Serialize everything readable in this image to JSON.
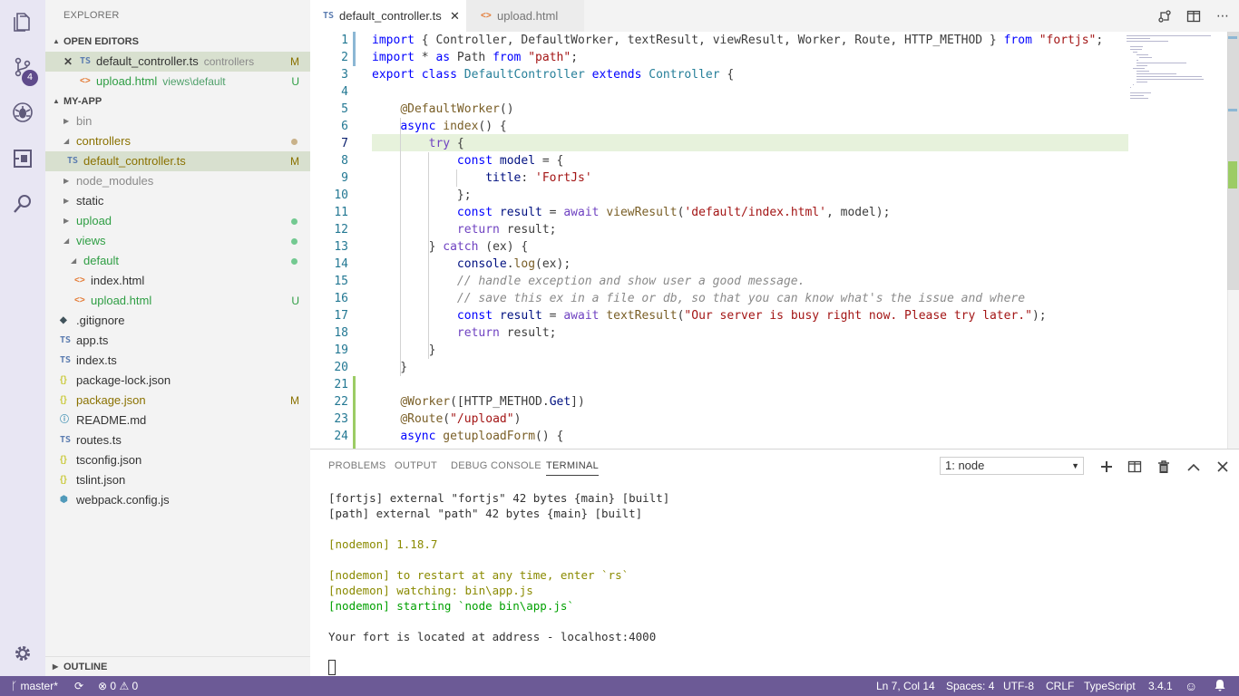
{
  "activity_bar": {
    "items": [
      {
        "icon": "files-icon"
      },
      {
        "icon": "source-control-icon",
        "badge": "4"
      },
      {
        "icon": "debug-icon"
      },
      {
        "icon": "extensions-icon"
      },
      {
        "icon": "search-icon"
      }
    ],
    "bottom": {
      "icon": "gear-icon"
    }
  },
  "sidebar": {
    "title": "EXPLORER",
    "open_editors": {
      "label": "OPEN EDITORS",
      "items": [
        {
          "icon_text": "TS",
          "name": "default_controller.ts",
          "desc": "controllers",
          "status": "M",
          "close": "✕"
        },
        {
          "icon_text": "<>",
          "name": "upload.html",
          "desc": "views\\default",
          "status": "U"
        }
      ]
    },
    "project": {
      "label": "MY-APP",
      "items": [
        {
          "name": "bin",
          "type": "folder"
        },
        {
          "name": "controllers",
          "type": "folder"
        },
        {
          "name": "default_controller.ts",
          "icon_text": "TS",
          "status": "M"
        },
        {
          "name": "node_modules",
          "type": "folder"
        },
        {
          "name": "static",
          "type": "folder"
        },
        {
          "name": "upload",
          "type": "folder"
        },
        {
          "name": "views",
          "type": "folder"
        },
        {
          "name": "default",
          "type": "folder"
        },
        {
          "name": "index.html",
          "icon_text": "<>"
        },
        {
          "name": "upload.html",
          "icon_text": "<>",
          "status": "U"
        },
        {
          "name": ".gitignore",
          "icon_text": "◆"
        },
        {
          "name": "app.ts",
          "icon_text": "TS"
        },
        {
          "name": "index.ts",
          "icon_text": "TS"
        },
        {
          "name": "package-lock.json",
          "icon_text": "{}"
        },
        {
          "name": "package.json",
          "icon_text": "{}",
          "status": "M"
        },
        {
          "name": "README.md",
          "icon_text": "ⓘ"
        },
        {
          "name": "routes.ts",
          "icon_text": "TS"
        },
        {
          "name": "tsconfig.json",
          "icon_text": "{}"
        },
        {
          "name": "tslint.json",
          "icon_text": "{}"
        },
        {
          "name": "webpack.config.js",
          "icon_text": "⬢"
        }
      ]
    },
    "outline": {
      "label": "OUTLINE"
    }
  },
  "tabs": [
    {
      "icon_text": "TS",
      "label": "default_controller.ts",
      "active": true,
      "close": "✕"
    },
    {
      "icon_text": "<>",
      "label": "upload.html",
      "active": false
    }
  ],
  "editor": {
    "lines": [
      {
        "n": "1",
        "parts": [
          [
            "kw",
            "import"
          ],
          [
            "pl",
            " { Controller, DefaultWorker, textResult, viewResult, Worker, Route, HTTP_METHOD } "
          ],
          [
            "kw",
            "from"
          ],
          [
            "pl",
            " "
          ],
          [
            "str",
            "\"fortjs\""
          ],
          [
            "pl",
            ";"
          ]
        ]
      },
      {
        "n": "2",
        "parts": [
          [
            "kw",
            "import"
          ],
          [
            "pl",
            " * "
          ],
          [
            "kw",
            "as"
          ],
          [
            "pl",
            " Path "
          ],
          [
            "kw",
            "from"
          ],
          [
            "pl",
            " "
          ],
          [
            "str",
            "\"path\""
          ],
          [
            "pl",
            ";"
          ]
        ]
      },
      {
        "n": "3",
        "parts": [
          [
            "kw",
            "export"
          ],
          [
            "pl",
            " "
          ],
          [
            "kw",
            "class"
          ],
          [
            "pl",
            " "
          ],
          [
            "cls",
            "DefaultController"
          ],
          [
            "pl",
            " "
          ],
          [
            "kw",
            "extends"
          ],
          [
            "pl",
            " "
          ],
          [
            "cls",
            "Controller"
          ],
          [
            "pl",
            " {"
          ]
        ]
      },
      {
        "n": "4",
        "parts": []
      },
      {
        "n": "5",
        "parts": [
          [
            "pl",
            "    "
          ],
          [
            "dec",
            "@DefaultWorker"
          ],
          [
            "pl",
            "()"
          ]
        ]
      },
      {
        "n": "6",
        "parts": [
          [
            "pl",
            "    "
          ],
          [
            "kw",
            "async"
          ],
          [
            "pl",
            " "
          ],
          [
            "fn",
            "index"
          ],
          [
            "pl",
            "() {"
          ]
        ]
      },
      {
        "n": "7",
        "parts": [
          [
            "pl",
            "        "
          ],
          [
            "kw2",
            "try"
          ],
          [
            "pl",
            " {"
          ]
        ]
      },
      {
        "n": "8",
        "parts": [
          [
            "pl",
            "            "
          ],
          [
            "kw",
            "const"
          ],
          [
            "pl",
            " "
          ],
          [
            "prop",
            "model"
          ],
          [
            "pl",
            " = {"
          ]
        ]
      },
      {
        "n": "9",
        "parts": [
          [
            "pl",
            "                "
          ],
          [
            "prop",
            "title"
          ],
          [
            "pl",
            ": "
          ],
          [
            "str",
            "'FortJs'"
          ]
        ]
      },
      {
        "n": "10",
        "parts": [
          [
            "pl",
            "            };"
          ]
        ]
      },
      {
        "n": "11",
        "parts": [
          [
            "pl",
            "            "
          ],
          [
            "kw",
            "const"
          ],
          [
            "pl",
            " "
          ],
          [
            "prop",
            "result"
          ],
          [
            "pl",
            " = "
          ],
          [
            "kw2",
            "await"
          ],
          [
            "pl",
            " "
          ],
          [
            "fn",
            "viewResult"
          ],
          [
            "pl",
            "("
          ],
          [
            "str",
            "'default/index.html'"
          ],
          [
            "pl",
            ", model);"
          ]
        ]
      },
      {
        "n": "12",
        "parts": [
          [
            "pl",
            "            "
          ],
          [
            "kw2",
            "return"
          ],
          [
            "pl",
            " result;"
          ]
        ]
      },
      {
        "n": "13",
        "parts": [
          [
            "pl",
            "        } "
          ],
          [
            "kw2",
            "catch"
          ],
          [
            "pl",
            " (ex) {"
          ]
        ]
      },
      {
        "n": "14",
        "parts": [
          [
            "pl",
            "            "
          ],
          [
            "prop",
            "console"
          ],
          [
            "pl",
            "."
          ],
          [
            "fn",
            "log"
          ],
          [
            "pl",
            "(ex);"
          ]
        ]
      },
      {
        "n": "15",
        "parts": [
          [
            "pl",
            "            "
          ],
          [
            "cmt",
            "// handle exception and show user a good message."
          ]
        ]
      },
      {
        "n": "16",
        "parts": [
          [
            "pl",
            "            "
          ],
          [
            "cmt",
            "// save this ex in a file or db, so that you can know what's the issue and where"
          ]
        ]
      },
      {
        "n": "17",
        "parts": [
          [
            "pl",
            "            "
          ],
          [
            "kw",
            "const"
          ],
          [
            "pl",
            " "
          ],
          [
            "prop",
            "result"
          ],
          [
            "pl",
            " = "
          ],
          [
            "kw2",
            "await"
          ],
          [
            "pl",
            " "
          ],
          [
            "fn",
            "textResult"
          ],
          [
            "pl",
            "("
          ],
          [
            "str",
            "\"Our server is busy right now. Please try later.\""
          ],
          [
            "pl",
            ");"
          ]
        ]
      },
      {
        "n": "18",
        "parts": [
          [
            "pl",
            "            "
          ],
          [
            "kw2",
            "return"
          ],
          [
            "pl",
            " result;"
          ]
        ]
      },
      {
        "n": "19",
        "parts": [
          [
            "pl",
            "        }"
          ]
        ]
      },
      {
        "n": "20",
        "parts": [
          [
            "pl",
            "    }"
          ]
        ]
      },
      {
        "n": "21",
        "parts": []
      },
      {
        "n": "22",
        "parts": [
          [
            "pl",
            "    "
          ],
          [
            "dec",
            "@Worker"
          ],
          [
            "pl",
            "([HTTP_METHOD."
          ],
          [
            "prop",
            "Get"
          ],
          [
            "pl",
            "])"
          ]
        ]
      },
      {
        "n": "23",
        "parts": [
          [
            "pl",
            "    "
          ],
          [
            "dec",
            "@Route"
          ],
          [
            "pl",
            "("
          ],
          [
            "str",
            "\"/upload\""
          ],
          [
            "pl",
            ")"
          ]
        ]
      },
      {
        "n": "24",
        "parts": [
          [
            "pl",
            "    "
          ],
          [
            "kw",
            "async"
          ],
          [
            "pl",
            " "
          ],
          [
            "fn",
            "getuploadForm"
          ],
          [
            "pl",
            "() {"
          ]
        ]
      }
    ],
    "current_line": "7"
  },
  "panel": {
    "tabs": [
      "PROBLEMS",
      "OUTPUT",
      "DEBUG CONSOLE",
      "TERMINAL"
    ],
    "active_tab": "TERMINAL",
    "terminal_select": "1: node",
    "terminal_lines": [
      {
        "text": "[fortjs] external \"fortjs\" 42 bytes {main} [built]",
        "color": "default"
      },
      {
        "text": "[path] external \"path\" 42 bytes {main} [built]",
        "color": "default"
      },
      {
        "text": "",
        "color": "default"
      },
      {
        "text": "[nodemon] 1.18.7",
        "color": "yellow"
      },
      {
        "text": "",
        "color": "default"
      },
      {
        "text": "[nodemon] to restart at any time, enter `rs`",
        "color": "yellow"
      },
      {
        "text": "[nodemon] watching: bin\\app.js",
        "color": "yellow"
      },
      {
        "text": "[nodemon] starting `node bin\\app.js`",
        "color": "green"
      },
      {
        "text": "",
        "color": "default"
      },
      {
        "text": "Your fort is located at address - localhost:4000",
        "color": "default"
      }
    ]
  },
  "statusbar": {
    "branch": "master*",
    "errors": "0",
    "warnings": "0",
    "position": "Ln 7, Col 14",
    "spaces": "Spaces: 4",
    "encoding": "UTF-8",
    "eol": "CRLF",
    "language": "TypeScript",
    "version": "3.4.1"
  },
  "colors": {
    "status_bar": "#6c5a96",
    "activity_bar": "#e8e6f3",
    "sidebar": "#f3f3f3",
    "selection": "#d8e0cf",
    "current_line": "#e7f2dc"
  }
}
